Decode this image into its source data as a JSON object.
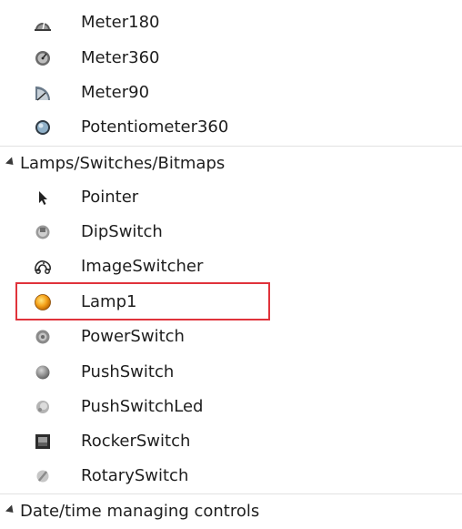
{
  "toolbox": {
    "items_top": [
      {
        "label": "Meter180",
        "icon": "meter180-icon"
      },
      {
        "label": "Meter360",
        "icon": "meter360-icon"
      },
      {
        "label": "Meter90",
        "icon": "meter90-icon"
      },
      {
        "label": "Potentiometer360",
        "icon": "potentiometer-icon"
      }
    ],
    "category_lamps": {
      "label": "Lamps/Switches/Bitmaps"
    },
    "items_lamps": [
      {
        "label": "Pointer",
        "icon": "pointer-arrow-icon"
      },
      {
        "label": "DipSwitch",
        "icon": "dipswitch-icon"
      },
      {
        "label": "ImageSwitcher",
        "icon": "imageswitcher-icon"
      },
      {
        "label": "Lamp1",
        "icon": "lamp-icon"
      },
      {
        "label": "PowerSwitch",
        "icon": "power-switch-icon"
      },
      {
        "label": "PushSwitch",
        "icon": "push-switch-icon"
      },
      {
        "label": "PushSwitchLed",
        "icon": "push-switch-led-icon"
      },
      {
        "label": "RockerSwitch",
        "icon": "rocker-switch-icon"
      },
      {
        "label": "RotarySwitch",
        "icon": "rotary-switch-icon"
      }
    ],
    "category_datetime": {
      "label": "Date/time managing controls"
    },
    "highlighted_item": "Lamp1",
    "highlight_color": "#e0333b"
  }
}
